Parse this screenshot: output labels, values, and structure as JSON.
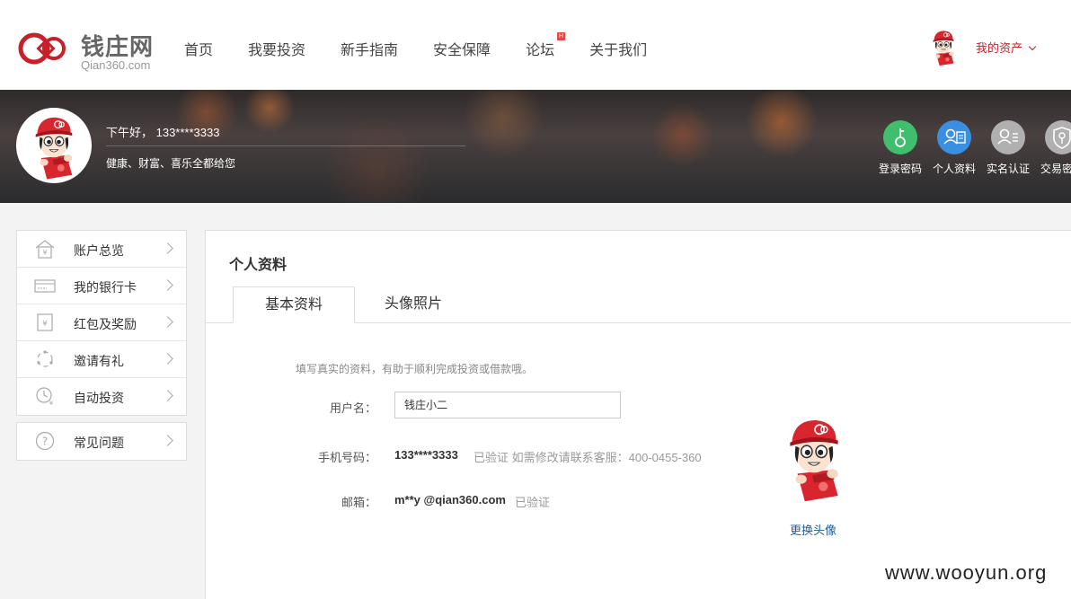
{
  "brand": {
    "name_cn": "钱庄网",
    "domain": "Qian360.com"
  },
  "nav": {
    "items": [
      "首页",
      "我要投资",
      "新手指南",
      "安全保障",
      "论坛",
      "关于我们"
    ],
    "forum_badge": "H"
  },
  "header": {
    "my_assets": "我的资产"
  },
  "banner": {
    "greeting": "下午好， 133****3333",
    "tagline": "健康、财富、喜乐全都给您",
    "security": [
      {
        "label": "登录密码",
        "color": "#3fbf6e",
        "icon": "key-icon"
      },
      {
        "label": "个人资料",
        "color": "#3b8fe0",
        "icon": "profile-card-icon"
      },
      {
        "label": "实名认证",
        "color": "#b0b0b0",
        "icon": "id-card-icon"
      },
      {
        "label": "交易密码",
        "color": "#b0b0b0",
        "icon": "shield-key-icon"
      }
    ]
  },
  "sidebar": {
    "items": [
      {
        "label": "账户总览",
        "icon": "home-yen-icon"
      },
      {
        "label": "我的银行卡",
        "icon": "bank-card-icon"
      },
      {
        "label": "红包及奖励",
        "icon": "red-envelope-icon"
      },
      {
        "label": "邀请有礼",
        "icon": "invite-icon"
      },
      {
        "label": "自动投资",
        "icon": "clock-yen-icon"
      }
    ],
    "faq": {
      "label": "常见问题",
      "icon": "question-icon"
    }
  },
  "profile": {
    "title": "个人资料",
    "tabs": [
      "基本资料",
      "头像照片"
    ],
    "hint": "填写真实的资料，有助于顺利完成投资或借款哦。",
    "username_label": "用户名：",
    "username_value": "钱庄小二",
    "phone_label": "手机号码：",
    "phone_value": "133****3333",
    "phone_status": "已验证 如需修改请联系客服：400-0455-360",
    "email_label": "邮箱：",
    "email_value": "m**y @qian360.com",
    "email_status": "已验证",
    "change_avatar": "更换头像"
  },
  "watermark": "www.wooyun.org",
  "colors": {
    "brand_red": "#c81f28",
    "link_blue": "#1f5c9c"
  }
}
